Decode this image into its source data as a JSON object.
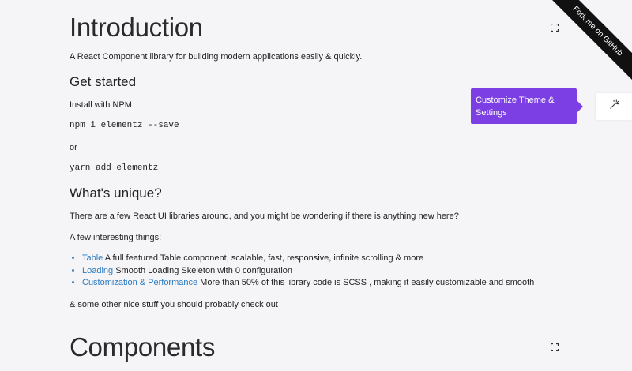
{
  "intro": {
    "title": "Introduction",
    "tagline": "A React Component library for buliding modern applications easily & quickly."
  },
  "get_started": {
    "heading": "Get started",
    "install_label": "Install with NPM",
    "npm_cmd": "npm i elementz --save",
    "or": "or",
    "yarn_cmd": "yarn add elementz"
  },
  "unique": {
    "heading": "What's unique?",
    "para1": "There are a few React UI libraries around, and you might be wondering if there is anything new here?",
    "para2": "A few interesting things:",
    "items": [
      {
        "link": "Table",
        "text": " A full featured Table component, scalable, fast, responsive, infinite scrolling & more"
      },
      {
        "link": "Loading",
        "text": " Smooth Loading Skeleton with 0 configuration"
      },
      {
        "link": "Customization & Performance",
        "text": " More than 50% of this library code is SCSS , making it easily customizable and smooth"
      }
    ],
    "closing": "& some other nice stuff you should probably check out"
  },
  "components": {
    "title": "Components"
  },
  "ribbon": {
    "label": "Fork me on GitHub"
  },
  "tooltip": {
    "text": "Customize Theme & Settings"
  },
  "icons": {
    "expand": "expand-icon",
    "settings": "magic-wand-icon"
  },
  "colors": {
    "accent": "#7b3fe4",
    "link": "#2a7ac0",
    "ribbon": "#111111"
  }
}
